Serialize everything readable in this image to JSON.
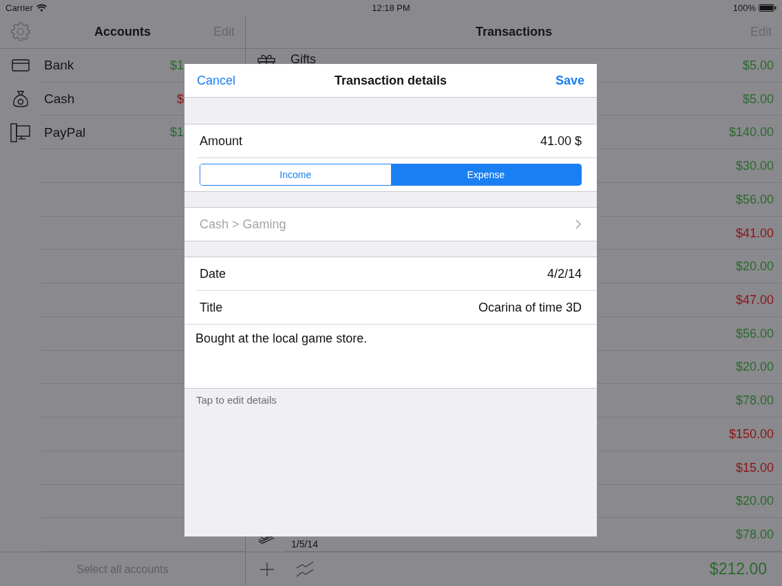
{
  "status_bar": {
    "carrier": "Carrier",
    "time": "12:18 PM",
    "battery": "100%"
  },
  "accounts": {
    "title": "Accounts",
    "edit": "Edit",
    "items": [
      {
        "name": "Bank",
        "amount": "$1",
        "color": "#2b6a2e"
      },
      {
        "name": "Cash",
        "amount": "$",
        "color": "#8c1416"
      },
      {
        "name": "PayPal",
        "amount": "$1",
        "color": "#2b6a2e"
      }
    ],
    "footer": "Select all accounts"
  },
  "transactions": {
    "title": "Transactions",
    "edit": "Edit",
    "rows": [
      {
        "title": "Gifts",
        "amount": "$5.00",
        "color": "#2b6a2e"
      },
      {
        "amount": "$5.00",
        "color": "#2b6a2e"
      },
      {
        "amount": "$140.00",
        "color": "#2b6a2e"
      },
      {
        "amount": "$30.00",
        "color": "#2b6a2e"
      },
      {
        "amount": "$56.00",
        "color": "#2b6a2e"
      },
      {
        "amount": "$41.00",
        "color": "#8c1416"
      },
      {
        "amount": "$20.00",
        "color": "#2b6a2e"
      },
      {
        "amount": "$47.00",
        "color": "#8c1416"
      },
      {
        "amount": "$56.00",
        "color": "#2b6a2e"
      },
      {
        "amount": "$20.00",
        "color": "#2b6a2e"
      },
      {
        "amount": "$78.00",
        "color": "#2b6a2e"
      },
      {
        "amount": "$150.00",
        "color": "#8c1416"
      },
      {
        "amount": "$15.00",
        "color": "#8c1416"
      },
      {
        "amount": "$20.00",
        "color": "#2b6a2e"
      },
      {
        "date": "1/5/14",
        "amount": "$78.00",
        "color": "#2b6a2e"
      }
    ],
    "total": "$212.00"
  },
  "modal": {
    "cancel": "Cancel",
    "title": "Transaction details",
    "save": "Save",
    "amount_label": "Amount",
    "amount_value": "41.00 $",
    "segments": [
      {
        "label": "Income",
        "selected": false
      },
      {
        "label": "Expense",
        "selected": true
      }
    ],
    "category": "Cash > Gaming",
    "date_label": "Date",
    "date_value": "4/2/14",
    "title_label": "Title",
    "title_value": "Ocarina of time 3D",
    "notes": "Bought at the local game store.",
    "hint": "Tap to edit details"
  }
}
